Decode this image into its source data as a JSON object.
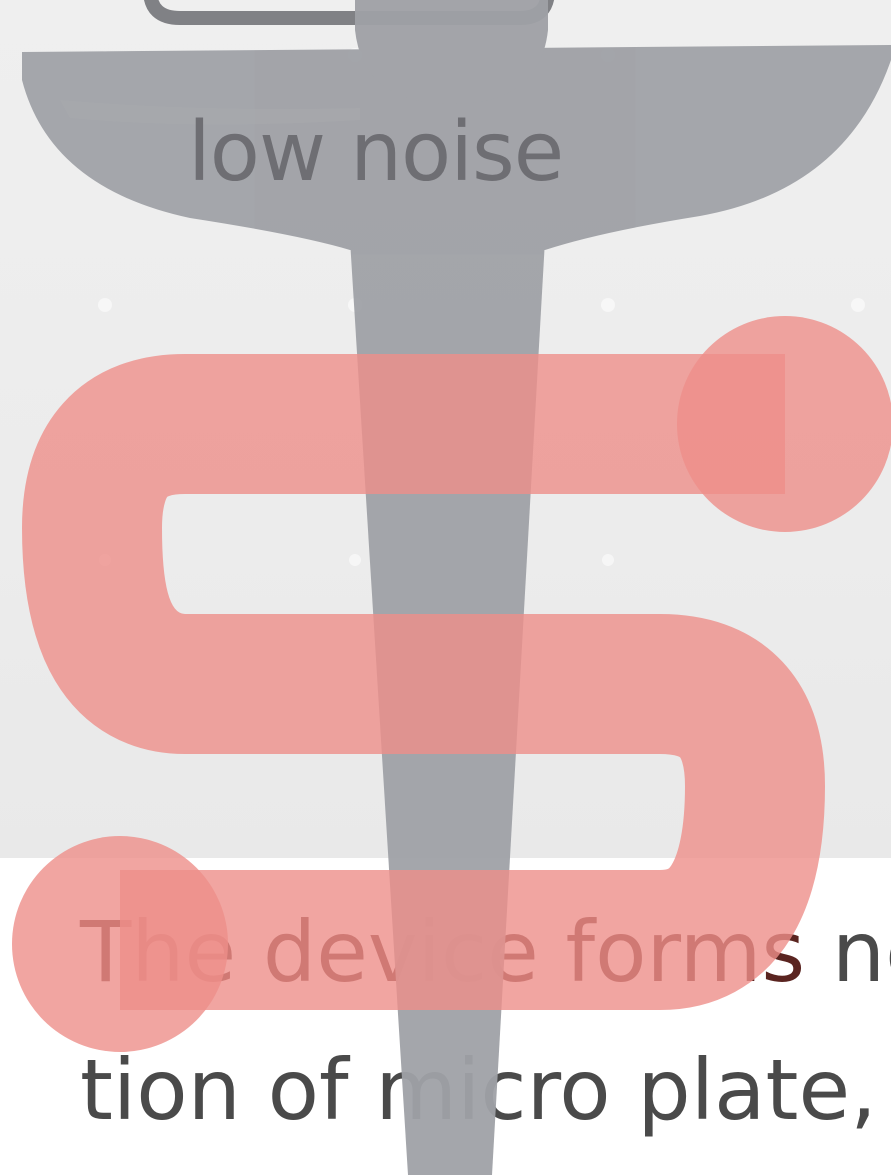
{
  "label": {
    "noise": "low noise"
  },
  "body": {
    "line1_highlight": "The device forms",
    "line1_rest": " ne",
    "line2": "tion of micro plate, "
  },
  "colors": {
    "panel_background": "#eeeeee",
    "stem_gray": "#9fa1a6",
    "serpentine_red": "#ee8f8a",
    "label_gray": "#6e6e73",
    "body_text": "#4a4a4a"
  },
  "icons": {
    "logo": "caduceus-serpent-icon"
  }
}
